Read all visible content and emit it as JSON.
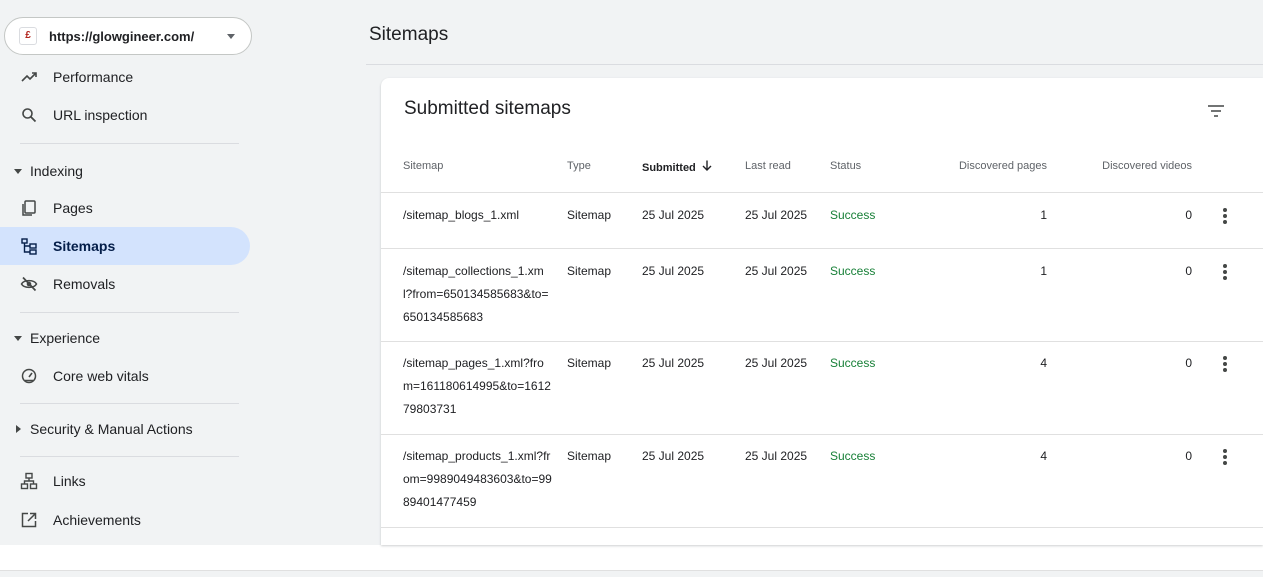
{
  "property": {
    "url": "https://glowgineer.com/",
    "favicon_text": "£"
  },
  "sidebar": {
    "top_items": [
      {
        "label": "Performance",
        "icon": "trending-up-icon"
      },
      {
        "label": "URL inspection",
        "icon": "search-icon"
      }
    ],
    "sections": [
      {
        "label": "Indexing",
        "expanded": true,
        "items": [
          {
            "label": "Pages",
            "icon": "pages-icon",
            "active": false
          },
          {
            "label": "Sitemaps",
            "icon": "sitemap-icon",
            "active": true
          },
          {
            "label": "Removals",
            "icon": "visibility-off-icon",
            "active": false
          }
        ]
      },
      {
        "label": "Experience",
        "expanded": true,
        "items": [
          {
            "label": "Core web vitals",
            "icon": "speed-gauge-icon"
          }
        ]
      },
      {
        "label": "Security & Manual Actions",
        "expanded": false,
        "items": []
      }
    ],
    "bottom_items": [
      {
        "label": "Links",
        "icon": "links-tree-icon"
      },
      {
        "label": "Achievements",
        "icon": "open-in-new-icon"
      }
    ]
  },
  "main": {
    "title": "Sitemaps"
  },
  "card": {
    "title": "Submitted sitemaps",
    "columns": {
      "sitemap": "Sitemap",
      "type": "Type",
      "submitted": "Submitted",
      "last_read": "Last read",
      "status": "Status",
      "discovered_pages": "Discovered pages",
      "discovered_videos": "Discovered videos"
    },
    "sort": {
      "column": "submitted",
      "direction": "descending"
    },
    "rows": [
      {
        "sitemap": "/sitemap_blogs_1.xml",
        "type": "Sitemap",
        "submitted": "25 Jul 2025",
        "last_read": "25 Jul 2025",
        "status": "Success",
        "pages": "1",
        "videos": "0"
      },
      {
        "sitemap": "/sitemap_collections_1.xml?from=650134585683&to=650134585683",
        "type": "Sitemap",
        "submitted": "25 Jul 2025",
        "last_read": "25 Jul 2025",
        "status": "Success",
        "pages": "1",
        "videos": "0"
      },
      {
        "sitemap": "/sitemap_pages_1.xml?from=161180614995&to=161279803731",
        "type": "Sitemap",
        "submitted": "25 Jul 2025",
        "last_read": "25 Jul 2025",
        "status": "Success",
        "pages": "4",
        "videos": "0"
      },
      {
        "sitemap": "/sitemap_products_1.xml?from=9989049483603&to=9989401477459",
        "type": "Sitemap",
        "submitted": "25 Jul 2025",
        "last_read": "25 Jul 2025",
        "status": "Success",
        "pages": "4",
        "videos": "0"
      }
    ]
  },
  "colors": {
    "active_nav": "#d3e3fd",
    "success": "#188038",
    "background": "#f1f3f4"
  }
}
